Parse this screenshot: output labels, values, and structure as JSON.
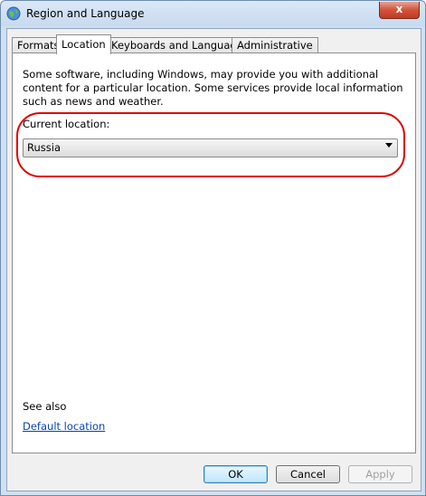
{
  "window": {
    "title": "Region and Language",
    "close_glyph": "x",
    "icon": "globe-icon"
  },
  "tabs": [
    {
      "label": "Formats",
      "active": false
    },
    {
      "label": "Location",
      "active": true
    },
    {
      "label": "Keyboards and Languages",
      "active": false
    },
    {
      "label": "Administrative",
      "active": false
    }
  ],
  "location": {
    "description": "Some software, including Windows, may provide you with additional content for a particular location. Some services provide local information such as news and weather.",
    "current_location_label": "Current location:",
    "selected_value": "Russia",
    "highlight_color": "#e00000"
  },
  "see_also": {
    "heading": "See also",
    "link_label": "Default location"
  },
  "buttons": {
    "ok": "OK",
    "cancel": "Cancel",
    "apply": "Apply"
  }
}
